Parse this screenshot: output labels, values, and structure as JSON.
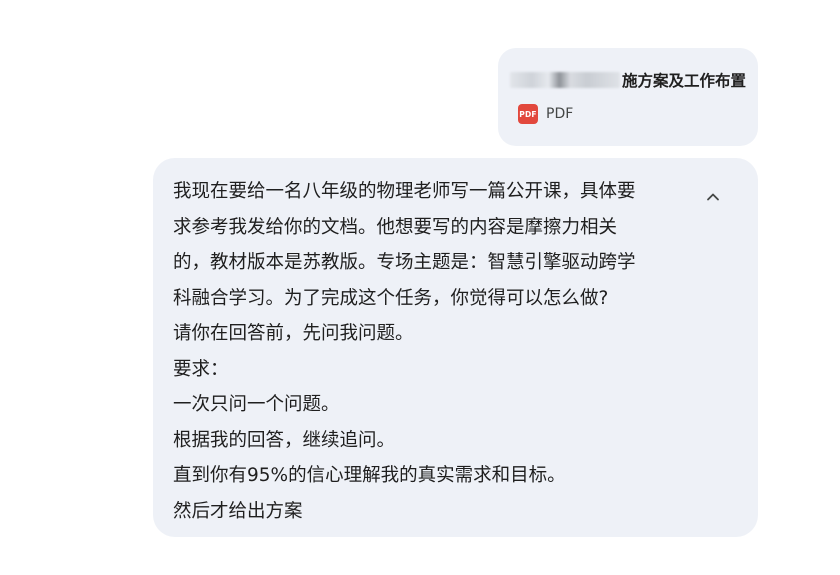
{
  "attachment": {
    "title_visible": "施方案及工作布置",
    "type_label": "PDF",
    "icon_text": "PDF",
    "icon": "pdf-file-icon",
    "icon_color": "#e2483d"
  },
  "message": {
    "lines": [
      "我现在要给一名八年级的物理老师写一篇公开课，具体要",
      "求参考我发给你的文档。他想要写的内容是摩擦力相关",
      "的，教材版本是苏教版。专场主题是：智慧引擎驱动跨学",
      "科融合学习。为了完成这个任务，你觉得可以怎么做?",
      "请你在回答前，先问我问题。",
      "要求：",
      "一次只问一个问题。",
      "根据我的回答，继续追问。",
      "直到你有95%的信心理解我的真实需求和目标。",
      "然后才给出方案"
    ],
    "collapse_icon": "chevron-up-icon"
  },
  "colors": {
    "bubble_bg": "#eef1f7",
    "text": "#1f1f1f"
  }
}
